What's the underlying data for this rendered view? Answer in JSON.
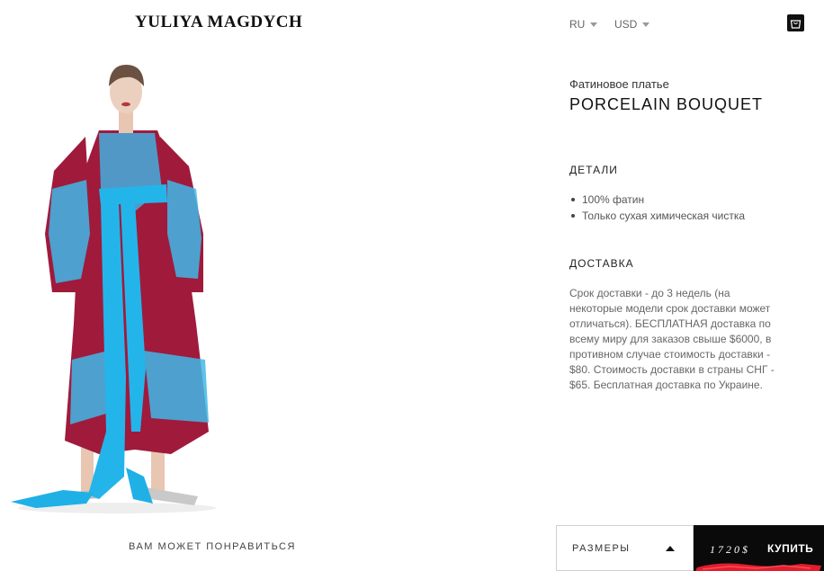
{
  "header": {
    "logo": "YULIYA MAGDYCH",
    "language": "RU",
    "currency": "USD"
  },
  "product": {
    "subtitle": "Фатиновое платье",
    "title": "PORCELAIN BOUQUET"
  },
  "details": {
    "heading": "ДЕТАЛИ",
    "items": [
      "100% фатин",
      "Только сухая химическая чистка"
    ]
  },
  "delivery": {
    "heading": "ДОСТАВКА",
    "text": "Срок доставки - до 3 недель (на некоторые модели срок доставки может отличаться). БЕСПЛАТНАЯ доставка по всему миру для заказов свыше $6000, в противном случае стоимость доставки - $80. Стоимость доставки в страны СНГ - $65. Бесплатная доставка по Украине."
  },
  "footer": {
    "recommend": "ВАМ МОЖЕТ ПОНРАВИТЬСЯ",
    "sizes": "РАЗМЕРЫ",
    "price": "1720$",
    "buy": "КУПИТЬ"
  },
  "colors": {
    "dress_red": "#a01a3c",
    "embroidery_blue": "#3fb8e8",
    "brush_red": "#e01e2e"
  },
  "icons": [
    "shopping-bag-icon",
    "caret-down-icon",
    "caret-up-icon"
  ]
}
